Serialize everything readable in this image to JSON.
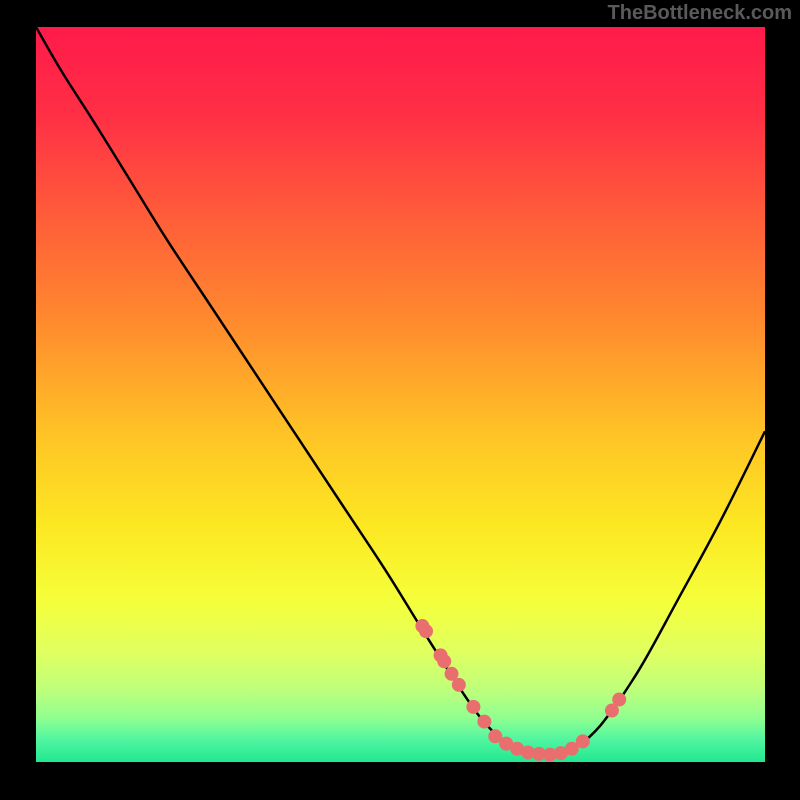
{
  "watermark": "TheBottleneck.com",
  "chart_data": {
    "type": "line",
    "title": "",
    "xlabel": "",
    "ylabel": "",
    "xlim": [
      0,
      100
    ],
    "ylim": [
      0,
      100
    ],
    "gradient_stops": [
      {
        "pos": 0.0,
        "color": "#ff1a4a"
      },
      {
        "pos": 0.12,
        "color": "#ff2f45"
      },
      {
        "pos": 0.25,
        "color": "#ff5a3a"
      },
      {
        "pos": 0.4,
        "color": "#ff8a2e"
      },
      {
        "pos": 0.55,
        "color": "#ffc226"
      },
      {
        "pos": 0.68,
        "color": "#fce822"
      },
      {
        "pos": 0.78,
        "color": "#f5ff3a"
      },
      {
        "pos": 0.85,
        "color": "#e0ff60"
      },
      {
        "pos": 0.9,
        "color": "#c0ff7a"
      },
      {
        "pos": 0.94,
        "color": "#90ff90"
      },
      {
        "pos": 0.97,
        "color": "#50f5a0"
      },
      {
        "pos": 1.0,
        "color": "#20e890"
      }
    ],
    "series": [
      {
        "name": "curve",
        "x": [
          0.0,
          3.5,
          8.0,
          13.0,
          18.0,
          24.0,
          30.0,
          36.0,
          42.0,
          48.0,
          53.0,
          57.5,
          61.0,
          64.0,
          67.0,
          70.0,
          73.0,
          76.0,
          79.0,
          83.0,
          88.0,
          94.0,
          100.0
        ],
        "y": [
          100.0,
          94.0,
          87.0,
          79.0,
          71.0,
          62.0,
          53.0,
          44.0,
          35.0,
          26.0,
          18.0,
          11.0,
          6.0,
          3.0,
          1.5,
          1.0,
          1.5,
          3.5,
          7.0,
          13.0,
          22.0,
          33.0,
          45.0
        ]
      }
    ],
    "markers": {
      "name": "points",
      "color": "#e96f6f",
      "radius": 7,
      "x": [
        53.0,
        53.5,
        55.5,
        56.0,
        57.0,
        58.0,
        60.0,
        61.5,
        63.0,
        64.5,
        66.0,
        67.5,
        69.0,
        70.5,
        72.0,
        73.5,
        75.0,
        79.0,
        80.0
      ],
      "y": [
        18.5,
        17.8,
        14.5,
        13.7,
        12.0,
        10.5,
        7.5,
        5.5,
        3.5,
        2.5,
        1.8,
        1.3,
        1.1,
        1.0,
        1.2,
        1.8,
        2.8,
        7.0,
        8.5
      ]
    }
  }
}
